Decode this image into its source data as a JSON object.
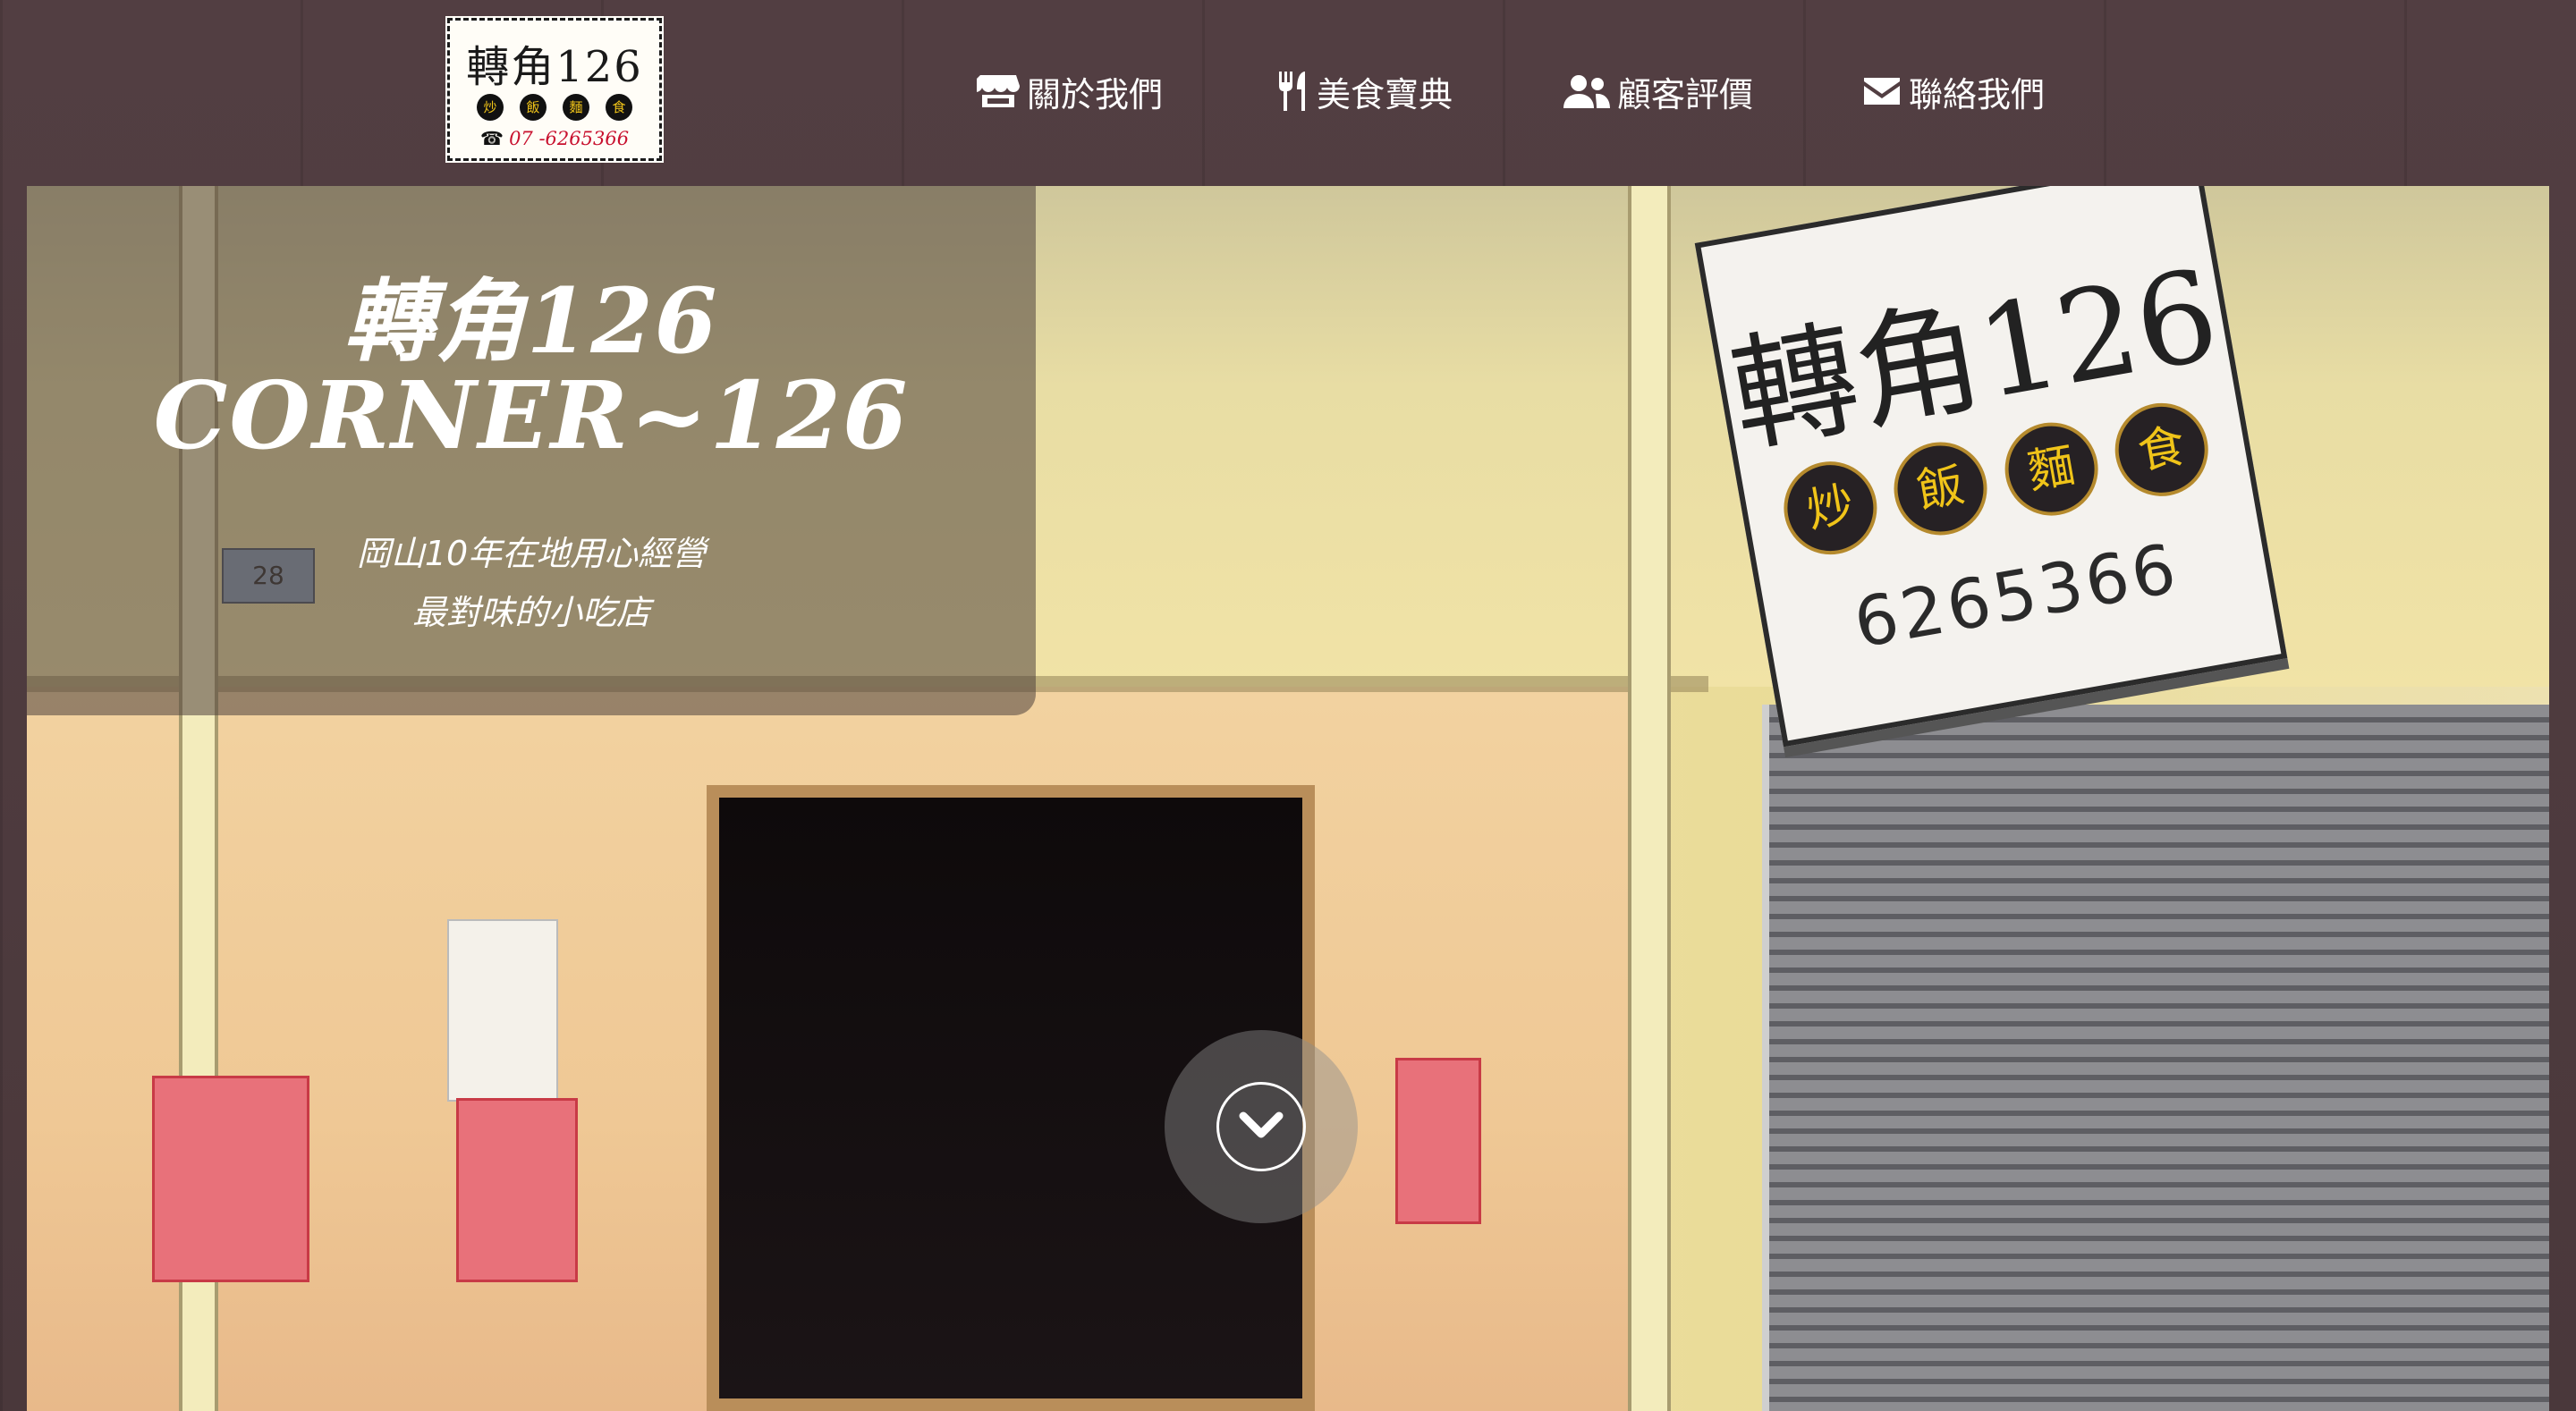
{
  "logo": {
    "title": "轉角126",
    "chars": [
      "炒",
      "飯",
      "麵",
      "食"
    ],
    "phone_icon": "☎",
    "phone": "07 -6265366"
  },
  "nav": {
    "items": [
      {
        "label": "關於我們",
        "icon": "store-icon"
      },
      {
        "label": "美食寶典",
        "icon": "utensils-icon"
      },
      {
        "label": "顧客評價",
        "icon": "users-icon"
      },
      {
        "label": "聯絡我們",
        "icon": "envelope-icon"
      }
    ]
  },
  "hero": {
    "title_line1": "轉角126",
    "title_line2": "CORNER~126",
    "subtitle_line1": "岡山10年在地用心經營",
    "subtitle_line2": "最對味的小吃店",
    "scroll_icon": "chevron-down-icon"
  },
  "storefront_sign": {
    "title": "轉角126",
    "chars": [
      "炒",
      "飯",
      "麵",
      "食"
    ],
    "phone": "6265366"
  },
  "house_number": "28",
  "colors": {
    "frame": "#4e3c3f",
    "nav_text": "#ffffff",
    "caption_overlay": "rgba(78,66,60,0.55)",
    "logo_phone": "#c8102e"
  }
}
